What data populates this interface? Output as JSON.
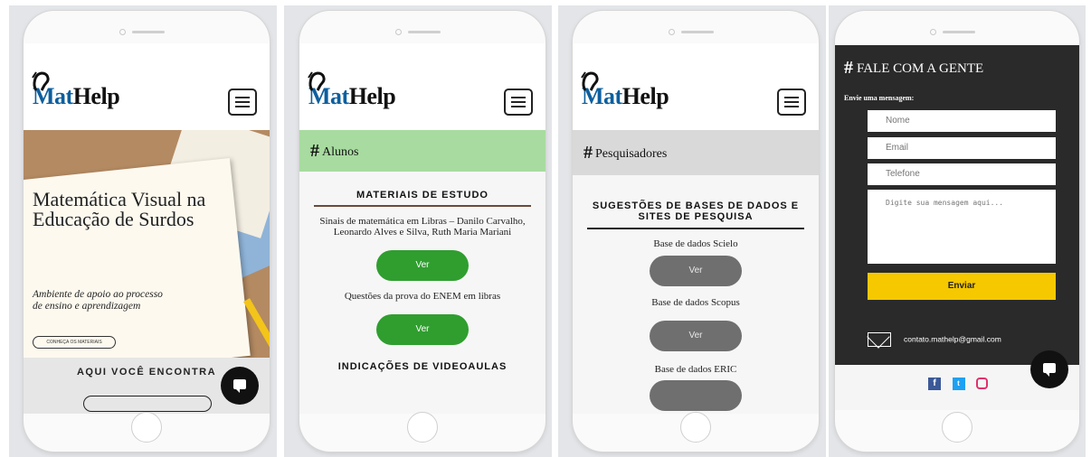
{
  "brand": {
    "logo_prefix": "Mat",
    "logo_rest": "Help"
  },
  "phone1": {
    "hero_title": "Matemática Visual na Educação de Surdos",
    "hero_subtitle": "Ambiente de apoio ao processo de ensino e aprendizagem",
    "hero_cta": "CONHEÇA OS MATERIAIS",
    "section_label": "AQUI VOCÊ ENCONTRA"
  },
  "phone2": {
    "category": "Alunos",
    "category_color": "#a8dba0",
    "section_title": "MATERIAIS DE ESTUDO",
    "items": [
      {
        "text": "Sinais de matemática em Libras – Danilo Carvalho, Leonardo Alves e Silva, Ruth Maria  Mariani",
        "button": "Ver"
      },
      {
        "text": "Questões da prova do ENEM em libras",
        "button": "Ver"
      }
    ],
    "next_section": "INDICAÇÕES DE VIDEOAULAS"
  },
  "phone3": {
    "category": "Pesquisadores",
    "category_color": "#d9d9d9",
    "section_title": "SUGESTÕES DE BASES DE DADOS E SITES DE PESQUISA",
    "items": [
      {
        "text": "Base de dados Scielo",
        "button": "Ver"
      },
      {
        "text": "Base de dados Scopus",
        "button": "Ver"
      },
      {
        "text": "Base de dados ERIC"
      }
    ]
  },
  "phone4": {
    "title": "FALE COM A GENTE",
    "subtitle": "Envie uma mensagem:",
    "fields": {
      "name": "Nome",
      "email": "Email",
      "phone": "Telefone",
      "message": "Digite sua mensagem aqui..."
    },
    "submit": "Enviar",
    "email_address": "contato.mathelp@gmail.com",
    "social": [
      "facebook-icon",
      "twitter-icon",
      "instagram-icon"
    ]
  }
}
